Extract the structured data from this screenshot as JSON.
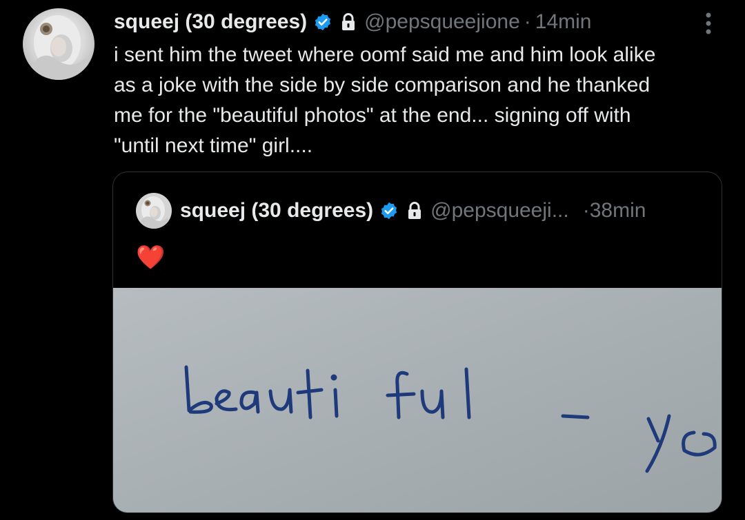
{
  "tweet": {
    "author_name": "squeej (30 degrees)",
    "handle": "@pepsqueejione",
    "separator": "·",
    "time": "14min",
    "text": "i sent him the tweet where oomf said me and him look alike\nas a joke with the side by side comparison and he thanked\nme for the \"beautiful photos\" at the end... signing off with\n\"until next time\" girl....",
    "icons": {
      "verified": "verified-badge-icon",
      "protected": "lock-icon",
      "more": "more-vertical-icon"
    }
  },
  "quote": {
    "author_name": "squeej (30 degrees)",
    "handle": "@pepsqueeji...",
    "separator": "·",
    "time": "38min",
    "text": "❤️",
    "media": {
      "handwritten_text": "beautiful - yo"
    }
  },
  "colors": {
    "background": "#000000",
    "primary_text": "#e7e9ea",
    "secondary_text": "#71767b",
    "verified_blue": "#1d9bf0",
    "border": "#2f3336",
    "ink": "#1f3a7a",
    "paper": "#a9b0b4"
  }
}
